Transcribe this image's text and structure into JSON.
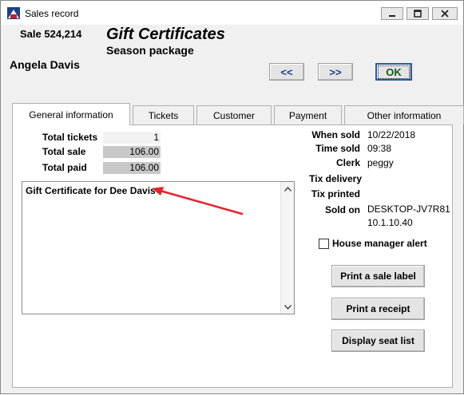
{
  "window": {
    "title": "Sales record",
    "controls": {
      "minimize": "minimize-icon",
      "maximize": "maximize-icon",
      "close": "close-icon"
    }
  },
  "header": {
    "sale_number": "Sale 524,214",
    "title": "Gift Certificates",
    "subtitle": "Season package",
    "customer_name": "Angela Davis",
    "prev_label": "<<",
    "next_label": ">>",
    "ok_label": "OK"
  },
  "tabs": [
    {
      "label": "General information",
      "active": true
    },
    {
      "label": "Tickets"
    },
    {
      "label": "Customer"
    },
    {
      "label": "Payment"
    },
    {
      "label": "Other information"
    }
  ],
  "totals": {
    "tickets_label": "Total tickets",
    "tickets_value": "1",
    "sale_label": "Total sale",
    "sale_value": "106.00",
    "paid_label": "Total paid",
    "paid_value": "106.00"
  },
  "notes": {
    "text": "Gift Certificate for Dee Davis"
  },
  "details": {
    "when_sold_label": "When sold",
    "when_sold_value": "10/22/2018",
    "time_sold_label": "Time sold",
    "time_sold_value": "09:38",
    "clerk_label": "Clerk",
    "clerk_value": "peggy",
    "tix_delivery_label": "Tix delivery",
    "tix_printed_label": "Tix printed",
    "sold_on_label": "Sold on",
    "sold_on_value": "DESKTOP-JV7R81",
    "sold_on_ip": "10.1.10.40"
  },
  "house_manager_alert": {
    "label": "House manager alert",
    "checked": false
  },
  "actions": {
    "print_sale_label": "Print a sale label",
    "print_receipt": "Print a receipt",
    "display_seat_list": "Display seat list"
  },
  "colors": {
    "annotation_arrow": "#e8202a",
    "nav_text": "#1a3c8a",
    "ok_text": "#0f5a23"
  }
}
